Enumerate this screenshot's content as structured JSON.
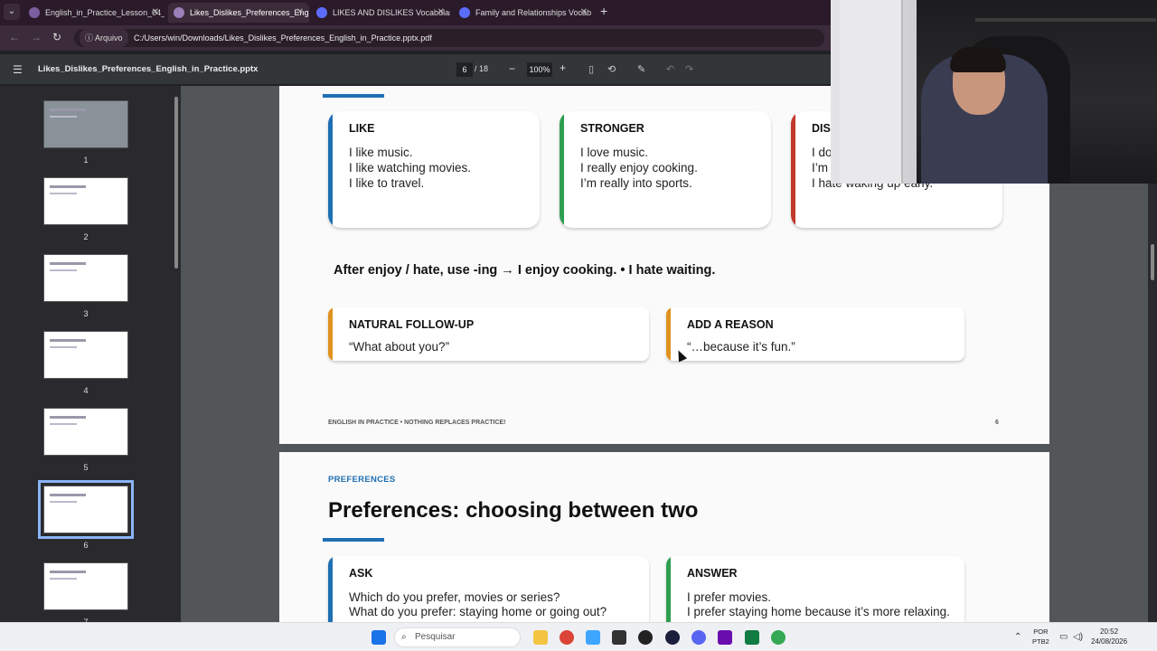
{
  "browser": {
    "tabs": [
      {
        "label": "English_in_Practice_Lesson_04_L",
        "active": false
      },
      {
        "label": "Likes_Dislikes_Preferences_Engli",
        "active": true
      },
      {
        "label": "LIKES AND DISLIKES Vocabulary",
        "active": false
      },
      {
        "label": "Family and Relationships Vocab",
        "active": false
      }
    ],
    "new_tab": "+",
    "address_chip": "Arquivo",
    "url": "C:/Users/win/Downloads/Likes_Dislikes_Preferences_English_in_Practice.pptx.pdf"
  },
  "pdf_toolbar": {
    "menu_icon": "menu-icon",
    "filename": "Likes_Dislikes_Preferences_English_in_Practice.pptx",
    "current_page": "6",
    "page_count": "/ 18",
    "zoom_minus": "−",
    "zoom": "100%",
    "zoom_plus": "+"
  },
  "thumbnails": {
    "numbers": [
      "1",
      "2",
      "3",
      "4",
      "5",
      "6",
      "7"
    ],
    "selected": 6
  },
  "slide6": {
    "cards": [
      {
        "title": "LIKE",
        "lines": [
          "I like music.",
          "I like watching movies.",
          "I like to travel."
        ],
        "color": "#1f6fb3"
      },
      {
        "title": "STRONGER",
        "lines": [
          "I love music.",
          "I really enjoy cooking.",
          "I’m really into sports."
        ],
        "color": "#2e9e4f"
      },
      {
        "title": "DIS",
        "lines": [
          "I do",
          "I’m",
          "I hate waking up early."
        ],
        "color": "#c0392b"
      }
    ],
    "rule": "After enjoy / hate, use -ing → I enjoy cooking. • I hate waiting.",
    "followups": [
      {
        "title": "NATURAL FOLLOW-UP",
        "line": "“What about you?”",
        "color": "#e0921f"
      },
      {
        "title": "ADD A REASON",
        "line": "“…because it’s fun.”",
        "color": "#e0921f"
      }
    ],
    "footer_left": "ENGLISH IN PRACTICE  •  NOTHING REPLACES PRACTICE!",
    "footer_right": "6"
  },
  "slide7": {
    "kicker": "PREFERENCES",
    "title": "Preferences: choosing between two",
    "cards": [
      {
        "title": "ASK",
        "lines": [
          "Which do you prefer, movies or series?",
          "What do you prefer: staying home or going out?"
        ],
        "color": "#1f6fb3"
      },
      {
        "title": "ANSWER",
        "lines": [
          "I prefer movies.",
          "I prefer staying home because it’s more relaxing."
        ],
        "color": "#2e9e4f"
      }
    ]
  },
  "taskbar": {
    "search_placeholder": "Pesquisar",
    "lang_top": "POR",
    "lang_bottom": "PTB2",
    "time": "20:52",
    "date": "24/08/2026"
  }
}
